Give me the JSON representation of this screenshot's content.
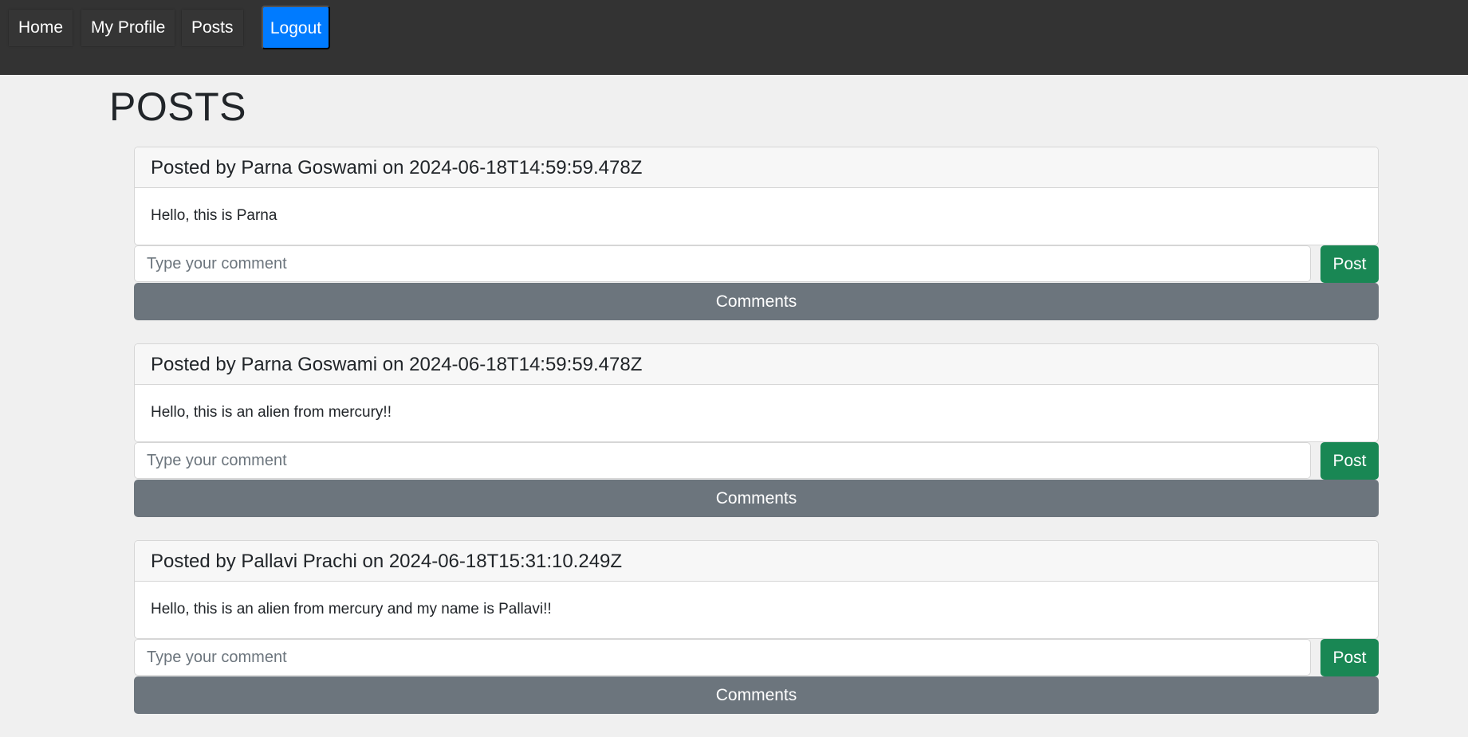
{
  "nav": {
    "home": "Home",
    "profile": "My Profile",
    "posts": "Posts",
    "logout": "Logout"
  },
  "page": {
    "title": "POSTS"
  },
  "posts": [
    {
      "header": "Posted by Parna Goswami on 2024-06-18T14:59:59.478Z",
      "body": "Hello, this is Parna",
      "comment_placeholder": "Type your comment",
      "post_label": "Post",
      "comments_label": "Comments"
    },
    {
      "header": "Posted by Parna Goswami on 2024-06-18T14:59:59.478Z",
      "body": "Hello, this is an alien from mercury!!",
      "comment_placeholder": "Type your comment",
      "post_label": "Post",
      "comments_label": "Comments"
    },
    {
      "header": "Posted by Pallavi Prachi on 2024-06-18T15:31:10.249Z",
      "body": "Hello, this is an alien from mercury and my name is Pallavi!!",
      "comment_placeholder": "Type your comment",
      "post_label": "Post",
      "comments_label": "Comments"
    }
  ],
  "colors": {
    "navbar_bg": "#333333",
    "logout_bg": "#007bff",
    "post_button_bg": "#198754",
    "comments_button_bg": "#6c757d",
    "page_bg": "#f0f0f0"
  }
}
